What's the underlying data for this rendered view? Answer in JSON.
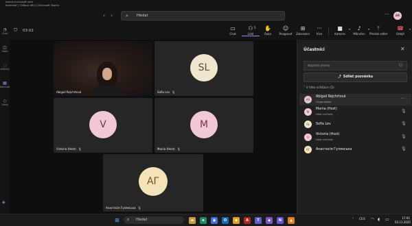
{
  "window": {
    "title_line1": "teams.microsoft.com",
    "title_line2": "Kalendář | Čtěbnú dění | Microsoft Teams"
  },
  "topbar": {
    "back": "‹",
    "forward": "›",
    "search_placeholder": "Hledat",
    "more": "···",
    "me_initials": "AR"
  },
  "rail": [
    {
      "icon": "◔",
      "label": "Chat"
    },
    {
      "icon": "◫",
      "label": "Sofia"
    },
    {
      "icon": "◌",
      "label": "Aktivity"
    },
    {
      "icon": "▦",
      "label": "Kalendář"
    },
    {
      "icon": "◇",
      "label": "Úkoly"
    }
  ],
  "toolbar": {
    "timer": "03:02",
    "buttons": [
      {
        "icon": "▭",
        "label": "Chat"
      },
      {
        "icon": "⚇",
        "label": "Lidé",
        "count": "5"
      },
      {
        "icon": "✋",
        "label": "Ruka"
      },
      {
        "icon": "☺",
        "label": "Reagovat"
      },
      {
        "icon": "⊞",
        "label": "Zobrazení"
      },
      {
        "icon": "···",
        "label": "Více"
      },
      {
        "icon": "■",
        "label": "Kamera"
      },
      {
        "icon": "♪",
        "label": "Mikrofon"
      },
      {
        "icon": "⤒",
        "label": "Přestat sdílet"
      },
      {
        "icon": "☎",
        "label": "Odejít"
      }
    ]
  },
  "tiles": [
    {
      "name": "Abigail Rejchrtová",
      "initials": "",
      "video": true
    },
    {
      "name": "Sofia Lev",
      "initials": "SL",
      "av_bg": "#f0e6d0",
      "av_fg": "#5b4d2c"
    },
    {
      "name": "Victoria (Host)",
      "initials": "V",
      "av_bg": "#f3c8d6",
      "av_fg": "#7a3045"
    },
    {
      "name": "Mariia (Host)",
      "initials": "M",
      "av_bg": "#f3c8d6",
      "av_fg": "#7a3045"
    },
    {
      "name": "Анастасія Гулянська",
      "initials": "АГ",
      "av_bg": "#f4e2b8",
      "av_fg": "#6b5420"
    }
  ],
  "panel": {
    "title": "Účastníci",
    "close": "✕",
    "search_placeholder": "Napište jméno",
    "share_label": "Sdílet pozvánku",
    "section": "V této schůzce (5)",
    "participants": [
      {
        "initials": "AR",
        "name": "Abigail Rejchrtová",
        "role": "Organizátor",
        "bg": "#e6c7cf",
        "fg": "#6a3b48",
        "action": "···"
      },
      {
        "initials": "M",
        "name": "Mariia (Host)",
        "role": "Host schůzky",
        "bg": "#f3c8d6",
        "fg": "#7a3045",
        "action": "🎙"
      },
      {
        "initials": "SL",
        "name": "Sofia Lev",
        "role": "",
        "bg": "#f0e6d0",
        "fg": "#5b4d2c",
        "action": "🎙"
      },
      {
        "initials": "V",
        "name": "Victoria (Host)",
        "role": "Host schůzky",
        "bg": "#f3c8d6",
        "fg": "#7a3045",
        "action": "🎙"
      },
      {
        "initials": "АГ",
        "name": "Анастасія Гулянська",
        "role": "",
        "bg": "#f4e2b8",
        "fg": "#6b5420",
        "action": "🎙"
      }
    ]
  },
  "taskbar": {
    "search": "Hledat",
    "lang": "CES",
    "time": "17:01",
    "date": "03.11.2025"
  }
}
